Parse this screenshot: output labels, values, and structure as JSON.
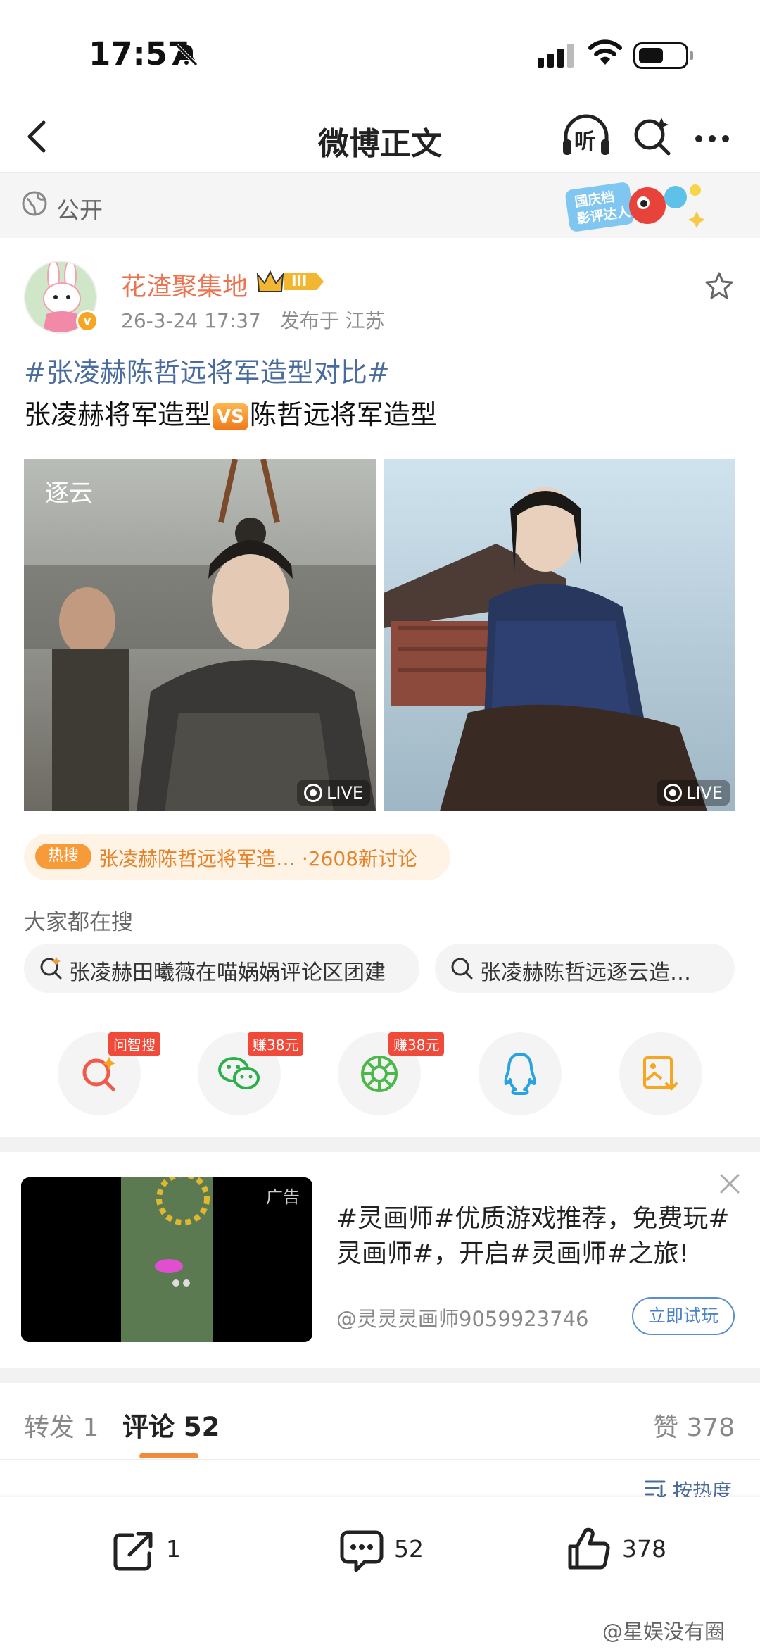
{
  "status_bar": {
    "time": "17:57"
  },
  "nav": {
    "title": "微博正文",
    "listen_label": "听"
  },
  "visibility": {
    "label": "公开",
    "promo_badge_text": "国庆档 影评达人"
  },
  "post": {
    "author": "花渣聚集地",
    "rank_badge": "III",
    "verified_mark": "v",
    "timestamp": "26-3-24 17:37",
    "location": "发布于 江苏",
    "hashtag": "#张凌赫陈哲远将军造型对比#",
    "body_before_vs": "张凌赫将军造型",
    "vs_label": "VS",
    "body_after_vs": "陈哲远将军造型",
    "images": [
      {
        "live_label": "LIVE",
        "watermark": "逐云"
      },
      {
        "live_label": "LIVE"
      }
    ]
  },
  "hot_search": {
    "tag": "热搜",
    "text": "张凌赫陈哲远将军造… ·2608新讨论"
  },
  "everyone_search": {
    "label": "大家都在搜",
    "chips": [
      "张凌赫田曦薇在喵娲娲评论区团建",
      "张凌赫陈哲远逐云造…"
    ]
  },
  "share_row": [
    {
      "icon": "ai-search-icon",
      "tag": "问智搜",
      "color": "#f05a4a"
    },
    {
      "icon": "wechat-icon",
      "tag": "赚38元",
      "color": "#2ab04a"
    },
    {
      "icon": "moments-icon",
      "tag": "赚38元",
      "color": "#4cb84a"
    },
    {
      "icon": "qq-icon",
      "tag": "",
      "color": "#29a3e0"
    },
    {
      "icon": "save-image-icon",
      "tag": "",
      "color": "#f5a623"
    }
  ],
  "ad": {
    "label": "广告",
    "text": "#灵画师#优质游戏推荐，免费玩#灵画师#，开启#灵画师#之旅!",
    "source": "@灵灵灵画师9059923746",
    "button": "立即试玩"
  },
  "tabs": {
    "repost": "转发 1",
    "comment_label": "评论",
    "comment_count": "52",
    "like": "赞 378"
  },
  "sort": {
    "label": "按热度"
  },
  "bottom_bar": {
    "repost_count": "1",
    "comment_count": "52",
    "like_count": "378"
  },
  "watermark": "@星娱没有圈",
  "colors": {
    "accent": "#eb7350",
    "link": "#4a6b9d",
    "hot": "#f79a38"
  }
}
